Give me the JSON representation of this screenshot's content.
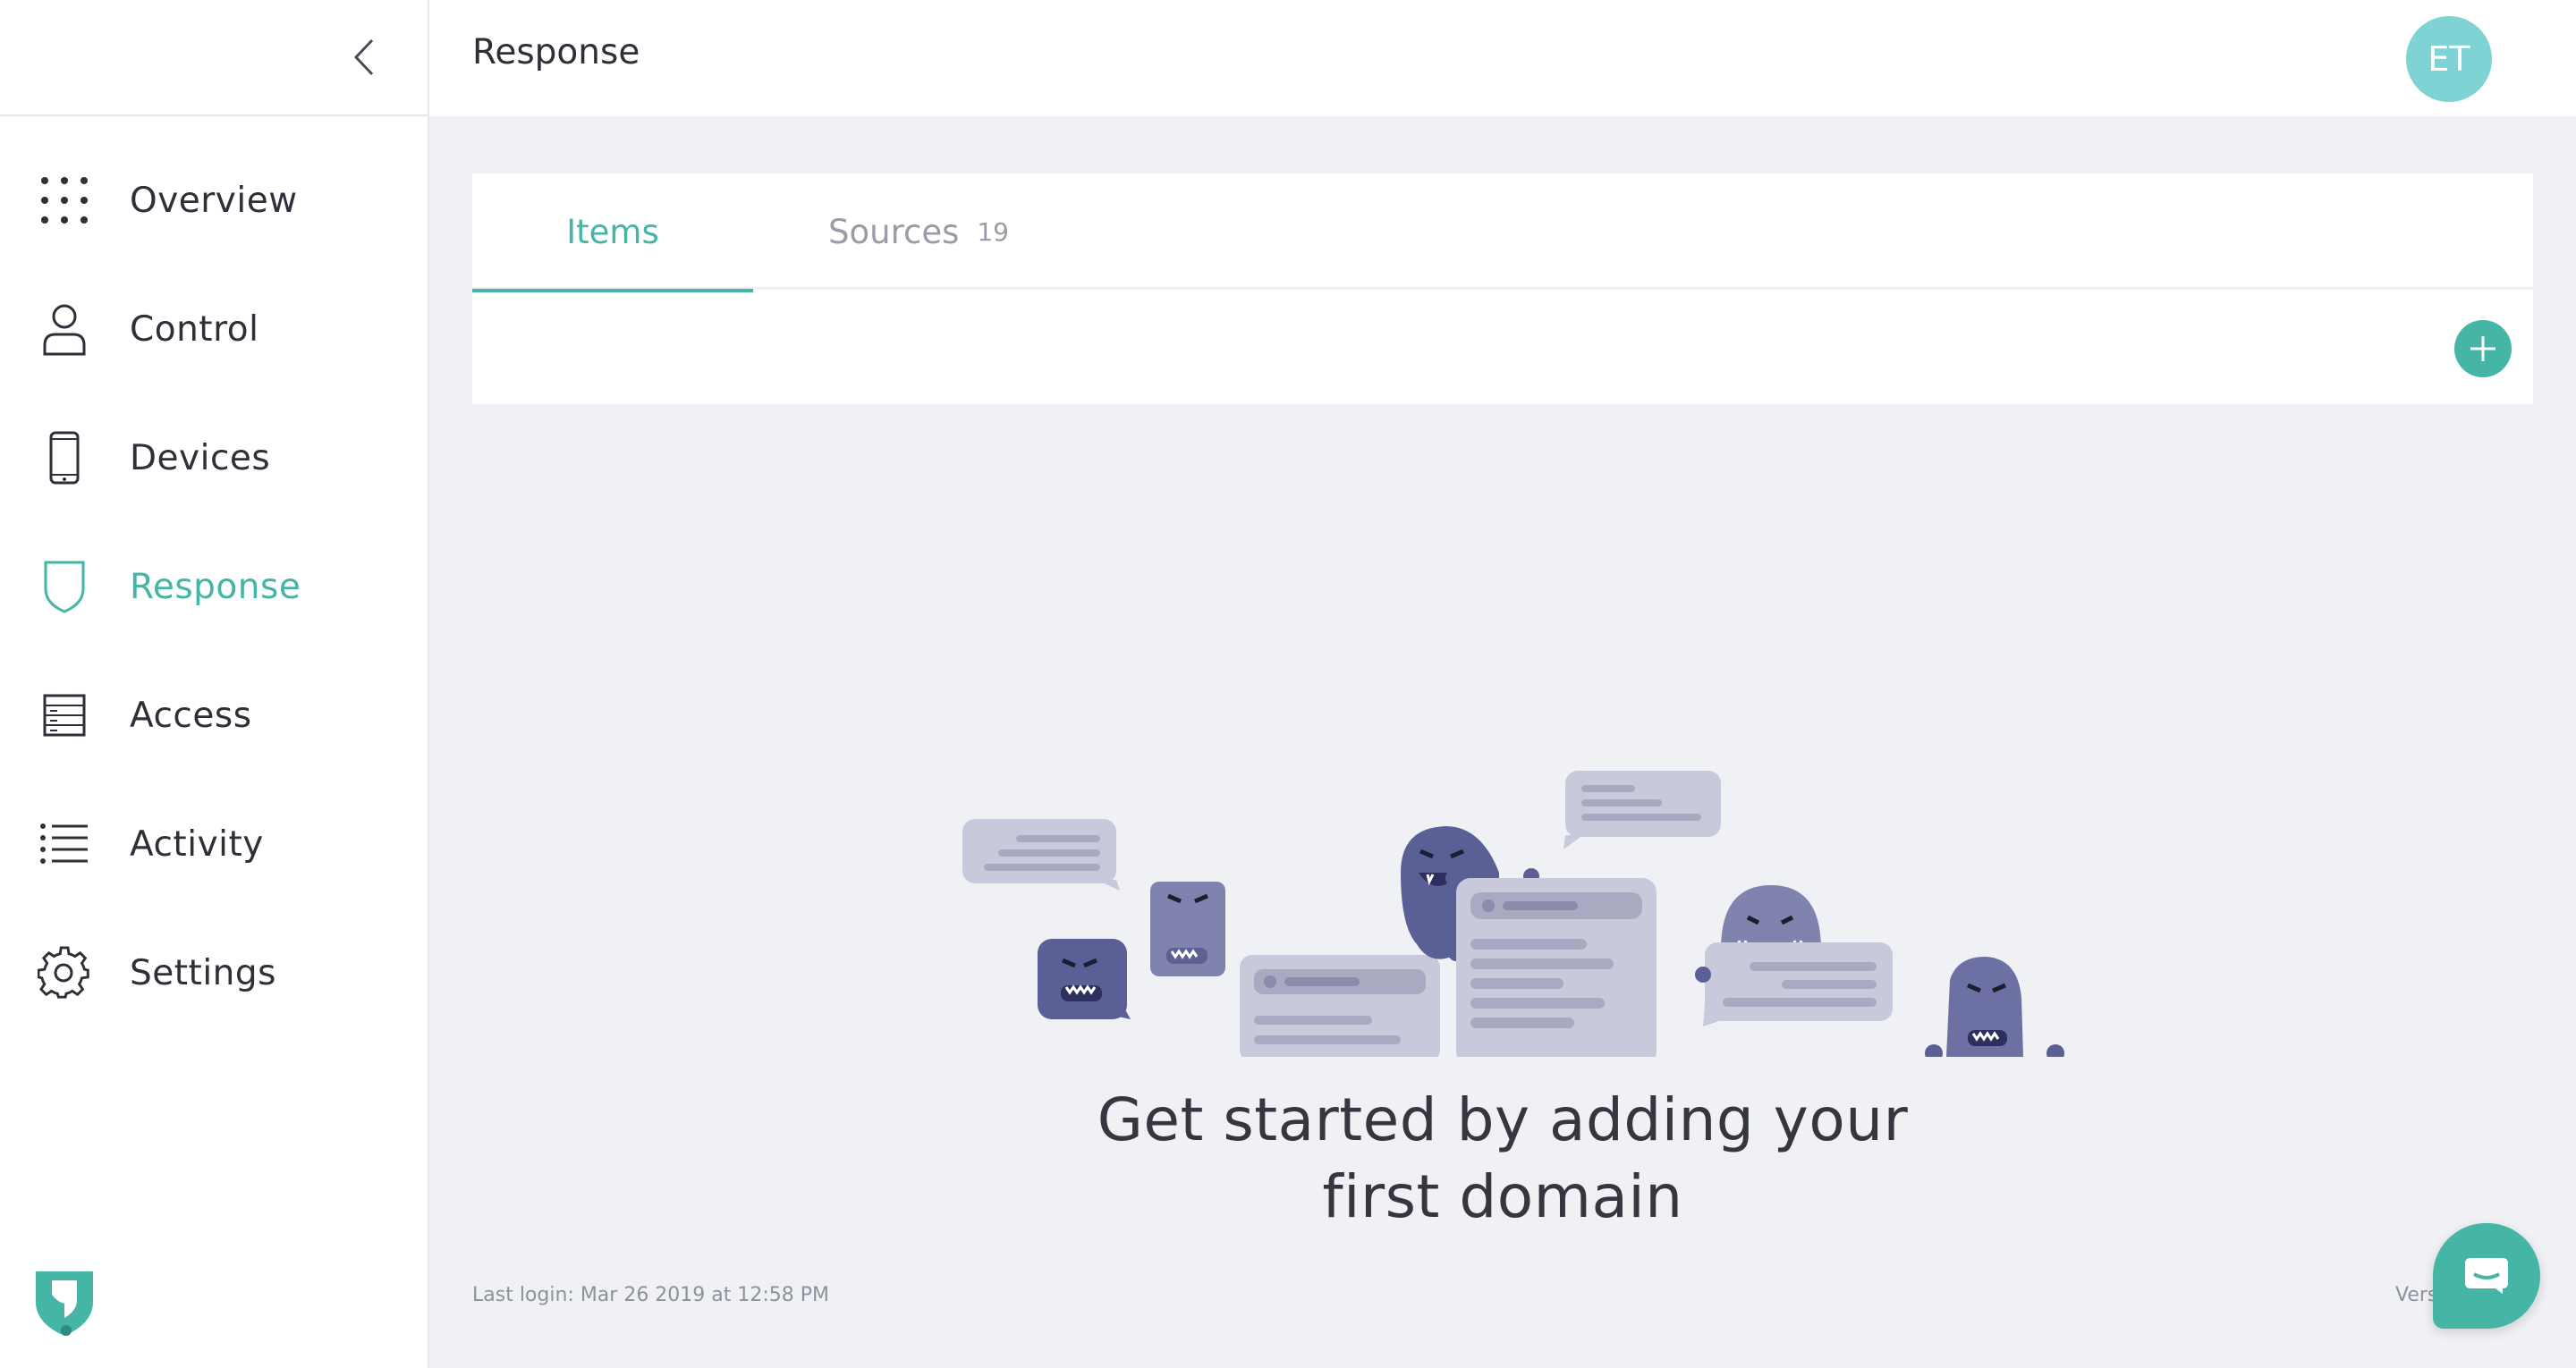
{
  "header": {
    "page_title": "Response",
    "avatar_initials": "ET"
  },
  "sidebar": {
    "items": [
      {
        "label": "Overview",
        "icon": "grid-dots-icon"
      },
      {
        "label": "Control",
        "icon": "person-icon"
      },
      {
        "label": "Devices",
        "icon": "phone-icon"
      },
      {
        "label": "Response",
        "icon": "shield-icon",
        "active": true
      },
      {
        "label": "Access",
        "icon": "server-icon"
      },
      {
        "label": "Activity",
        "icon": "list-icon"
      },
      {
        "label": "Settings",
        "icon": "gear-icon"
      }
    ]
  },
  "tabs": {
    "items_label": "Items",
    "sources_label": "Sources",
    "sources_count": "19"
  },
  "empty_state": {
    "title_line1": "Get started by adding your",
    "title_line2": "first domain"
  },
  "footer": {
    "last_login": "Last login: Mar 26 2019 at 12:58 PM",
    "version": "Vers"
  },
  "colors": {
    "accent": "#45b5a6",
    "avatar": "#7fd3d4",
    "monster": "#5a5f96",
    "bubble": "#c8c9da"
  }
}
